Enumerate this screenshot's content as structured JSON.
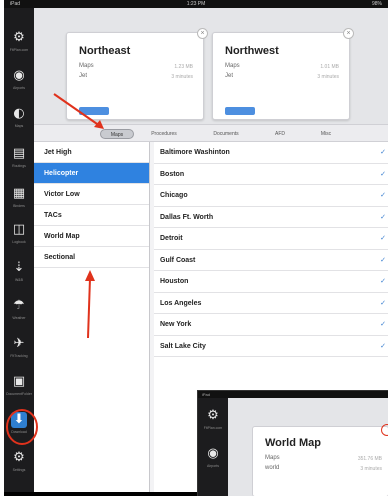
{
  "status": {
    "left": "iPad",
    "time": "1:23 PM",
    "right": "98%"
  },
  "sidebar": {
    "items": [
      {
        "icon": "⚙",
        "label": "FltPlan.com"
      },
      {
        "icon": "◉",
        "label": "Airports"
      },
      {
        "icon": "◐",
        "label": "Maps"
      },
      {
        "icon": "▤",
        "label": "Routings"
      },
      {
        "icon": "▦",
        "label": "Binders"
      },
      {
        "icon": "◫",
        "label": "Logbook"
      },
      {
        "icon": "⇣",
        "label": "W&B"
      },
      {
        "icon": "☂",
        "label": "Weather"
      },
      {
        "icon": "✈",
        "label": "FltTracking"
      },
      {
        "icon": "▣",
        "label": "DocumentFolder"
      },
      {
        "icon": "⬇",
        "label": "Download"
      },
      {
        "icon": "⚙",
        "label": "Settings"
      }
    ]
  },
  "cards": [
    {
      "title": "Northeast",
      "row1": "Maps",
      "row2": "Jet",
      "val1": "1.23 MB",
      "val2": "3 minutes"
    },
    {
      "title": "Northwest",
      "row1": "Maps",
      "row2": "Jet",
      "val1": "1.01 MB",
      "val2": "3 minutes"
    }
  ],
  "tabs": [
    "Maps",
    "Procedures",
    "Documents",
    "AFD",
    "Misc"
  ],
  "left_list": [
    "Jet High",
    "Helicopter",
    "Victor Low",
    "TACs",
    "World Map",
    "Sectional"
  ],
  "right_list": [
    "Baltimore Washinton",
    "Boston",
    "Chicago",
    "Dallas Ft. Worth",
    "Detroit",
    "Gulf Coast",
    "Houston",
    "Los Angeles",
    "New York",
    "Salt Lake City"
  ],
  "inset": {
    "status": "iPad",
    "title": "World Map",
    "row1": "Maps",
    "row2": "world",
    "val1": "351.76 MB",
    "val2": "3 minutes",
    "side_labels": [
      "FltPlan.com",
      "Airports"
    ]
  },
  "colors": {
    "accent": "#2f82e0",
    "annotation": "#e0321c"
  }
}
